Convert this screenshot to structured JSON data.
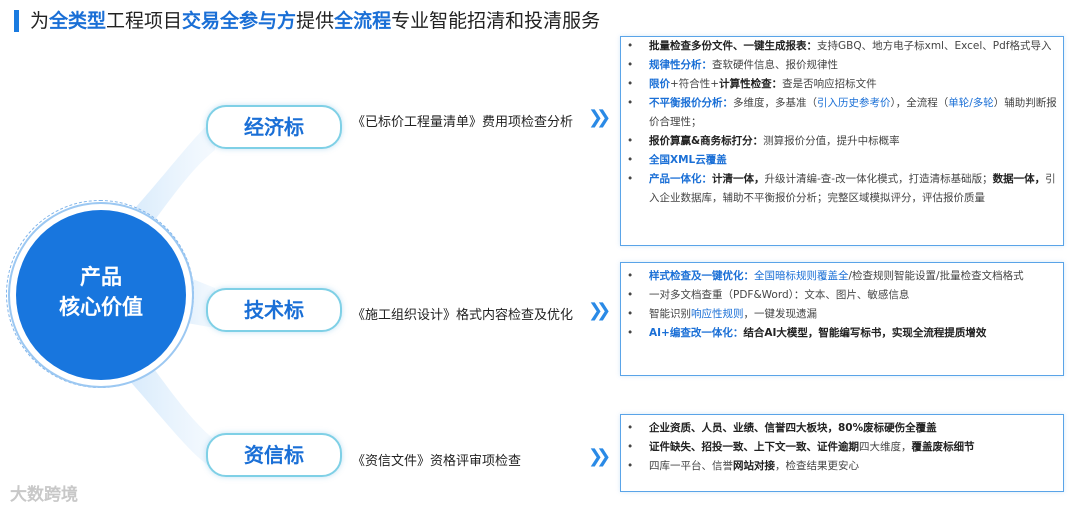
{
  "title": {
    "parts": [
      {
        "text": "为",
        "hl": false
      },
      {
        "text": "全类型",
        "hl": true
      },
      {
        "text": "工程项目",
        "hl": false
      },
      {
        "text": "交易全参与方",
        "hl": true
      },
      {
        "text": "提供",
        "hl": false
      },
      {
        "text": "全流程",
        "hl": true
      },
      {
        "text": "专业智能招清和投清服务",
        "hl": false
      }
    ]
  },
  "core": {
    "line1": "产品",
    "line2": "核心价值"
  },
  "branches": [
    {
      "label": "经济标",
      "desc": "《已标价工程量清单》费用项检查分析",
      "items": [
        [
          {
            "t": "批量检查多份文件、一键生成报表：",
            "s": "b"
          },
          {
            "t": "支持GBQ、地方电子标xml、Excel、Pdf格式导入",
            "s": ""
          }
        ],
        [
          {
            "t": "规律性分析：",
            "s": "bl"
          },
          {
            "t": "查软硬件信息、报价规律性",
            "s": ""
          }
        ],
        [
          {
            "t": "限价",
            "s": "bl"
          },
          {
            "t": "+符合性+",
            "s": ""
          },
          {
            "t": "计算性检查：",
            "s": "b"
          },
          {
            "t": "查是否响应招标文件",
            "s": ""
          }
        ],
        [
          {
            "t": "不平衡报价分析：",
            "s": "bl"
          },
          {
            "t": "多维度，多基准（",
            "s": ""
          },
          {
            "t": "引入历史参考价",
            "s": "lk"
          },
          {
            "t": "），全流程（",
            "s": ""
          },
          {
            "t": "单轮/多轮",
            "s": "lk"
          },
          {
            "t": "）辅助判断报价合理性；",
            "s": ""
          }
        ],
        [
          {
            "t": "报价算赢&商务标打分：",
            "s": "b"
          },
          {
            "t": "测算报价分值，提升中标概率",
            "s": ""
          }
        ],
        [
          {
            "t": "全国XML云覆盖",
            "s": "bl"
          }
        ],
        [
          {
            "t": "产品一体化：",
            "s": "bl"
          },
          {
            "t": "计清一体，",
            "s": "b"
          },
          {
            "t": "升级计清编-查-改一体化模式，打造清标基础版；",
            "s": ""
          },
          {
            "t": "数据一体，",
            "s": "b"
          },
          {
            "t": "引入企业数据库，辅助不平衡报价分析；完整区域模拟评分，评估报价质量",
            "s": ""
          }
        ]
      ]
    },
    {
      "label": "技术标",
      "desc": "《施工组织设计》格式内容检查及优化",
      "items": [
        [
          {
            "t": "样式检查及一键优化：",
            "s": "bl"
          },
          {
            "t": "全国暗标规则覆盖全",
            "s": "lk"
          },
          {
            "t": "/检查规则智能设置/批量检查文档格式",
            "s": ""
          }
        ],
        [
          {
            "t": "一对多文档查重（PDF&Word）：文本、图片、敏感信息",
            "s": ""
          }
        ],
        [
          {
            "t": "智能识别",
            "s": ""
          },
          {
            "t": "响应性规则",
            "s": "lk"
          },
          {
            "t": "，一键发现遗漏",
            "s": ""
          }
        ],
        [
          {
            "t": "AI+编查改一体化：",
            "s": "bl"
          },
          {
            "t": "结合AI大模型，智能编写标书，实现全流程提质增效",
            "s": "b"
          }
        ]
      ]
    },
    {
      "label": "资信标",
      "desc": "《资信文件》资格评审项检查",
      "items": [
        [
          {
            "t": "企业资质、人员、业绩、信誉四大板块，80%废标硬伤全覆盖",
            "s": "b"
          }
        ],
        [
          {
            "t": "证件缺失、招投一致、上下文一致、证件逾期",
            "s": "b"
          },
          {
            "t": "四大维度，",
            "s": ""
          },
          {
            "t": "覆盖废标细节",
            "s": "b"
          }
        ],
        [
          {
            "t": "四库一平台、信誉",
            "s": ""
          },
          {
            "t": "网站对接",
            "s": "b"
          },
          {
            "t": "，检查结果更安心",
            "s": ""
          }
        ]
      ]
    }
  ],
  "watermark": "大数跨境",
  "colors": {
    "accent": "#1a6fd6",
    "core": "#1876de",
    "box_border": "#5aa4e8",
    "pill_border": "#7fd0e6"
  }
}
